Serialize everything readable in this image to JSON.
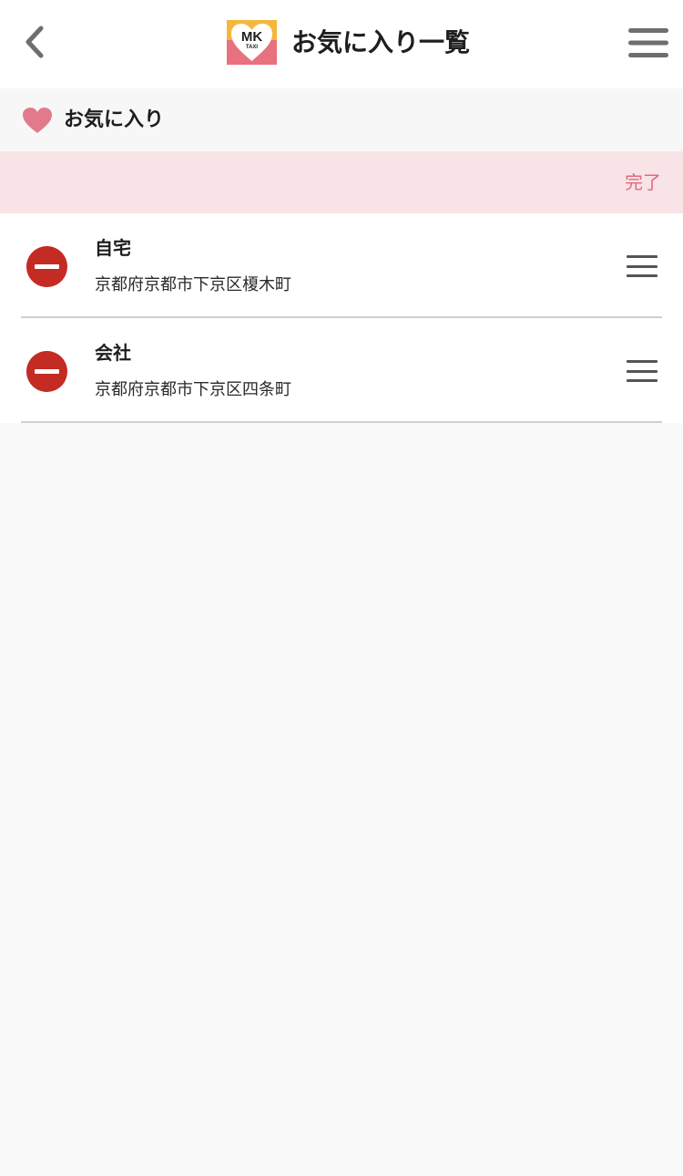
{
  "header": {
    "title": "お気に入り一覧",
    "logo_text": "MK",
    "logo_subtext": "TAXI"
  },
  "section": {
    "title": "お気に入り"
  },
  "edit_bar": {
    "done_label": "完了"
  },
  "favorites": [
    {
      "name": "自宅",
      "address": "京都府京都市下京区榎木町"
    },
    {
      "name": "会社",
      "address": "京都府京都市下京区四条町"
    }
  ],
  "colors": {
    "accent_pink": "#e06b7e",
    "edit_bar_bg": "#f8e3e6",
    "delete_red": "#c42b22",
    "heart_pink": "#e37a8b"
  },
  "icons": {
    "back": "chevron-left-icon",
    "menu": "hamburger-menu-icon",
    "heart": "heart-icon",
    "delete": "minus-circle-icon",
    "reorder": "drag-handle-icon"
  }
}
